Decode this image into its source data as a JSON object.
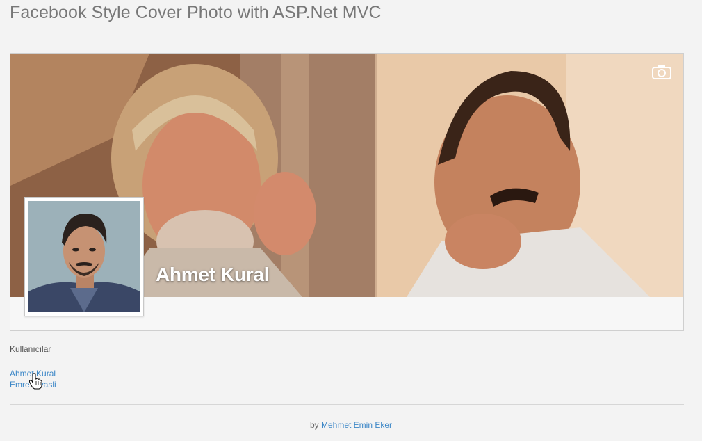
{
  "page": {
    "title": "Facebook Style Cover Photo with ASP.Net MVC"
  },
  "profile": {
    "name": "Ahmet Kural"
  },
  "users": {
    "heading": "Kullanıcılar",
    "items": [
      {
        "label": "Ahmet Kural"
      },
      {
        "label": "Emre Şivasli"
      }
    ]
  },
  "footer": {
    "prefix": "by",
    "author": "Mehmet Emin Eker"
  },
  "icons": {
    "camera": "camera-icon",
    "cursor": "hand-pointer-cursor"
  },
  "colors": {
    "link": "#3c87c7",
    "background": "#f3f3f3",
    "title": "#777777"
  }
}
